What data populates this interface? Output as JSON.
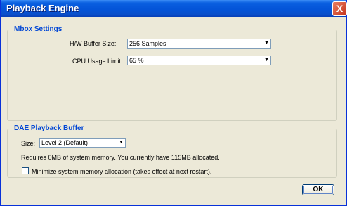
{
  "window": {
    "title": "Playback Engine",
    "close_label": "X"
  },
  "mbox": {
    "title": "Mbox Settings",
    "buffer_size_label": "H/W Buffer Size:",
    "buffer_size_value": "256 Samples",
    "cpu_limit_label": "CPU Usage Limit:",
    "cpu_limit_value": "65 %"
  },
  "dae": {
    "title": "DAE Playback Buffer",
    "size_label": "Size:",
    "size_value": "Level 2 (Default)",
    "memory_text": "Requires 0MB of system memory. You currently have 115MB allocated.",
    "minimize_label": "Minimize system memory allocation (takes effect at next restart).",
    "minimize_checked": false
  },
  "buttons": {
    "ok": "OK"
  },
  "icons": {
    "dropdown": "chevron-down-icon",
    "close": "close-icon"
  },
  "colors": {
    "titlebar": "#0454d8",
    "group_title": "#0046d5",
    "dialog_bg": "#ece9d8"
  }
}
